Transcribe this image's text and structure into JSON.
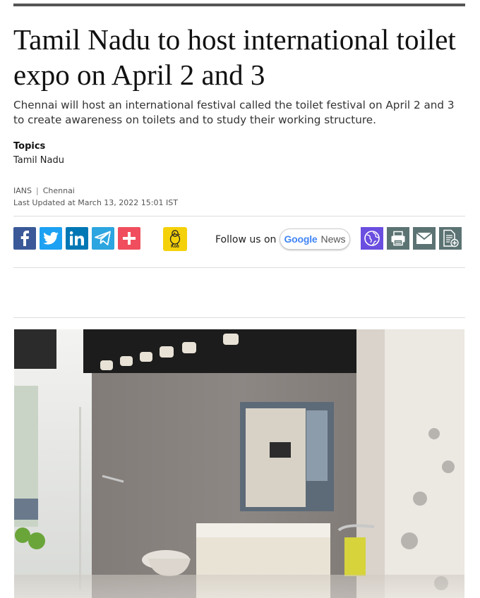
{
  "article": {
    "headline": "Tamil Nadu to host international toilet expo on April 2 and 3",
    "summary": "Chennai will host an international festival called the toilet festival on April 2 and 3 to create awareness on toilets and to study their working structure.",
    "topics_label": "Topics",
    "topic": "Tamil Nadu",
    "author": "IANS",
    "location": "Chennai",
    "last_updated": "Last Updated at March 13, 2022 15:01 IST"
  },
  "share": {
    "icons": [
      "facebook-icon",
      "twitter-icon",
      "linkedin-icon",
      "telegram-icon",
      "more-icon"
    ],
    "koo_label": "Koo",
    "follow_text": "Follow us on",
    "google_label": "Google",
    "news_label": "News",
    "tools": [
      "translate-icon",
      "print-icon",
      "email-icon",
      "save-article-icon"
    ]
  },
  "colors": {
    "facebook": "#3b5998",
    "twitter": "#1da1f2",
    "linkedin": "#0077b5",
    "telegram": "#2ca5e0",
    "more": "#f04e5e",
    "koo": "#f5d10a",
    "translate": "#6a4ee0",
    "tools": "#5c7373"
  }
}
